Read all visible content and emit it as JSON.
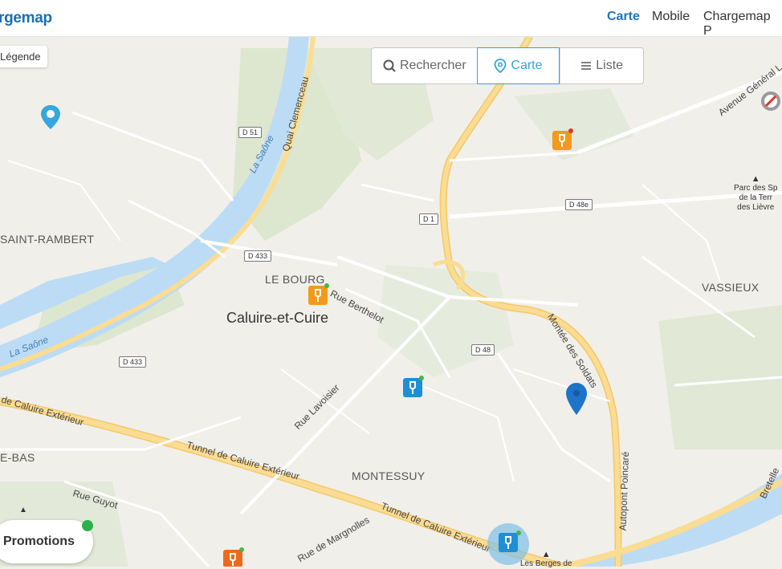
{
  "header": {
    "logo": "rgemap",
    "nav": [
      {
        "label": "Carte",
        "active": true
      },
      {
        "label": "Mobile",
        "active": false
      },
      {
        "label": "Chargemap P",
        "active": false
      }
    ]
  },
  "controls": {
    "legend_label": "Légende",
    "search_label": "Rechercher",
    "map_label": "Carte",
    "list_label": "Liste",
    "promotions_label": "Promotions"
  },
  "map": {
    "districts": [
      "SAINT-RAMBERT",
      "LE BOURG",
      "VASSIEUX",
      "MONTESSUY",
      "E-BAS"
    ],
    "town": "Caluire-et-Cuire",
    "rivers": [
      "La Saône",
      "La Saône"
    ],
    "streets": [
      "Quai Clemenceau",
      "Rue Berthelot",
      "Montée des Soldats",
      "Rue Lavoisier",
      "de Caluire Extérieur",
      "Tunnel de Caluire Extérieur",
      "Tunnel de Caluire Extérieur",
      "Rue Guyot",
      "Rue de Margnolles",
      "Autopont Poincaré",
      "Avenue Général L",
      "Bretelle"
    ],
    "road_badges": [
      "D 51",
      "D 1",
      "D 48e",
      "D 433",
      "D 433",
      "D 48"
    ],
    "pois": [
      "Parc des Sp",
      "de la Terr",
      "des Lièvre",
      "Les Berges de"
    ],
    "colors": {
      "water": "#bcdcf5",
      "highway": "#f9d57e",
      "park": "#d9e4cc",
      "land": "#f1efea",
      "accent": "#2aa8d8",
      "station_orange": "#f29a1b",
      "station_blue": "#1e8fd6"
    }
  },
  "markers": [
    {
      "type": "pin-blue",
      "icon": "map-pin-icon"
    },
    {
      "type": "pin-blue",
      "icon": "map-pin-icon"
    },
    {
      "type": "station-orange",
      "icon": "charging-station-icon",
      "status": "red"
    },
    {
      "type": "station-orange",
      "icon": "charging-station-icon",
      "status": "green"
    },
    {
      "type": "station-blue",
      "icon": "charging-station-icon",
      "status": "green"
    },
    {
      "type": "station-blue-cluster",
      "icon": "charging-station-icon",
      "status": "green"
    },
    {
      "type": "station-orange",
      "icon": "charging-station-icon",
      "status": "green"
    },
    {
      "type": "station-disabled",
      "icon": "no-entry-icon"
    }
  ]
}
